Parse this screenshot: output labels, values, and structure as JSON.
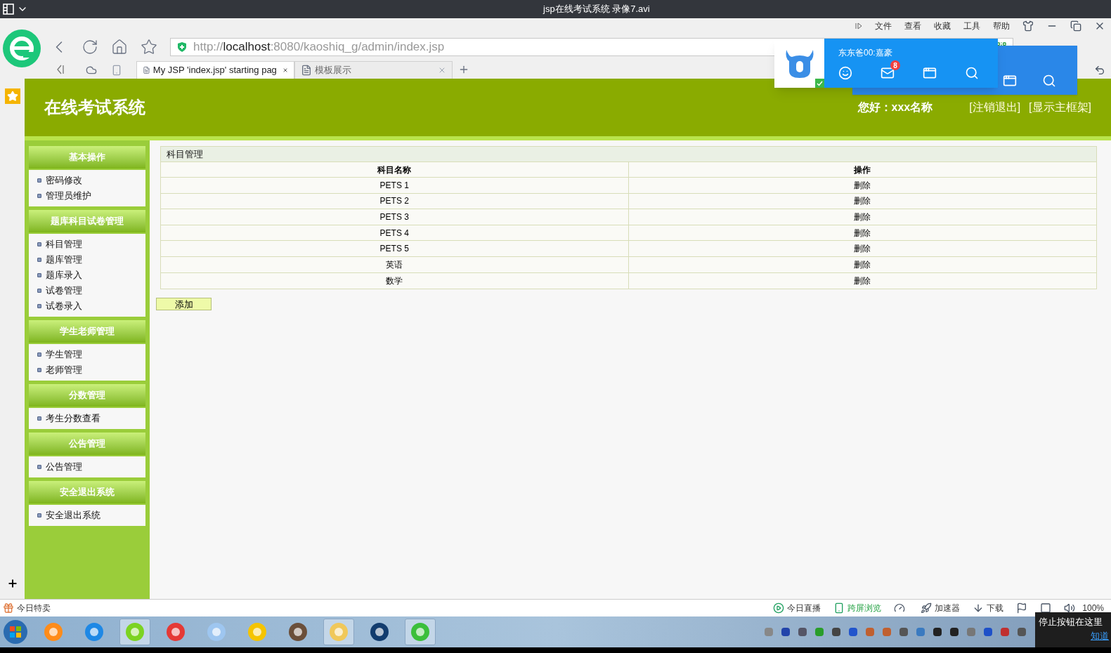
{
  "window": {
    "title": "jsp在线考试系统 录像7.avi"
  },
  "browser": {
    "menu": [
      "文件",
      "查看",
      "收藏",
      "工具",
      "帮助"
    ],
    "url": "http://**localhost**:8080/kaoshiq_g/admin/index.jsp",
    "tabs": [
      {
        "label": "My JSP 'index.jsp' starting pag",
        "selected": true
      },
      {
        "label": "模板展示",
        "selected": false
      }
    ]
  },
  "notification": {
    "user": "东东爸00:嘉豪",
    "mail_count": "8"
  },
  "header": {
    "title": "在线考试系统",
    "greeting": "您好：xxx名称",
    "links": [
      "[注销退出]",
      "[显示主框架]"
    ]
  },
  "sidebar": [
    {
      "title": "基本操作",
      "items": [
        "密码修改",
        "管理员维护"
      ]
    },
    {
      "title": "题库科目试卷管理",
      "items": [
        "科目管理",
        "题库管理",
        "题库录入",
        "试卷管理",
        "试卷录入"
      ]
    },
    {
      "title": "学生老师管理",
      "items": [
        "学生管理",
        "老师管理"
      ]
    },
    {
      "title": "分数管理",
      "items": [
        "考生分数查看"
      ]
    },
    {
      "title": "公告管理",
      "items": [
        "公告管理"
      ]
    },
    {
      "title": "安全退出系统",
      "items": [
        "安全退出系统"
      ]
    }
  ],
  "panel": {
    "title": "科目管理",
    "columns": [
      "科目名称",
      "操作"
    ],
    "rows": [
      {
        "name": "PETS 1",
        "action": "删除"
      },
      {
        "name": "PETS 2",
        "action": "删除"
      },
      {
        "name": "PETS 3",
        "action": "删除"
      },
      {
        "name": "PETS 4",
        "action": "删除"
      },
      {
        "name": "PETS 5",
        "action": "删除"
      },
      {
        "name": "英语",
        "action": "删除"
      },
      {
        "name": "数学",
        "action": "删除"
      }
    ],
    "add_button": "添加"
  },
  "status_bar": {
    "left": "今日特卖",
    "items": [
      {
        "kind": "live",
        "label": "今日直播"
      },
      {
        "kind": "cross",
        "label": "跨屏浏览"
      },
      {
        "kind": "speed",
        "label": "加速器"
      },
      {
        "kind": "download",
        "label": "下载"
      }
    ],
    "zoom": "100%"
  },
  "tooltip": {
    "text": "停止按钮在这里",
    "link": "知道"
  }
}
